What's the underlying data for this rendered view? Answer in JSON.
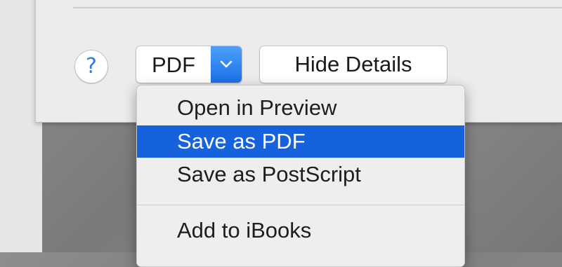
{
  "dialog": {
    "help_icon": "question-mark-icon",
    "help_glyph": "?",
    "pdf_button_label": "PDF",
    "pdf_arrow_icon": "chevron-down-icon",
    "hide_details_label": "Hide Details"
  },
  "pdf_menu": {
    "items": [
      {
        "label": "Open in Preview",
        "selected": false
      },
      {
        "label": "Save as PDF",
        "selected": true
      },
      {
        "label": "Save as PostScript",
        "selected": false
      },
      {
        "label": "Add to iBooks",
        "selected": false
      }
    ]
  },
  "colors": {
    "accent": "#1662dd",
    "help_glyph": "#2f7de1"
  }
}
